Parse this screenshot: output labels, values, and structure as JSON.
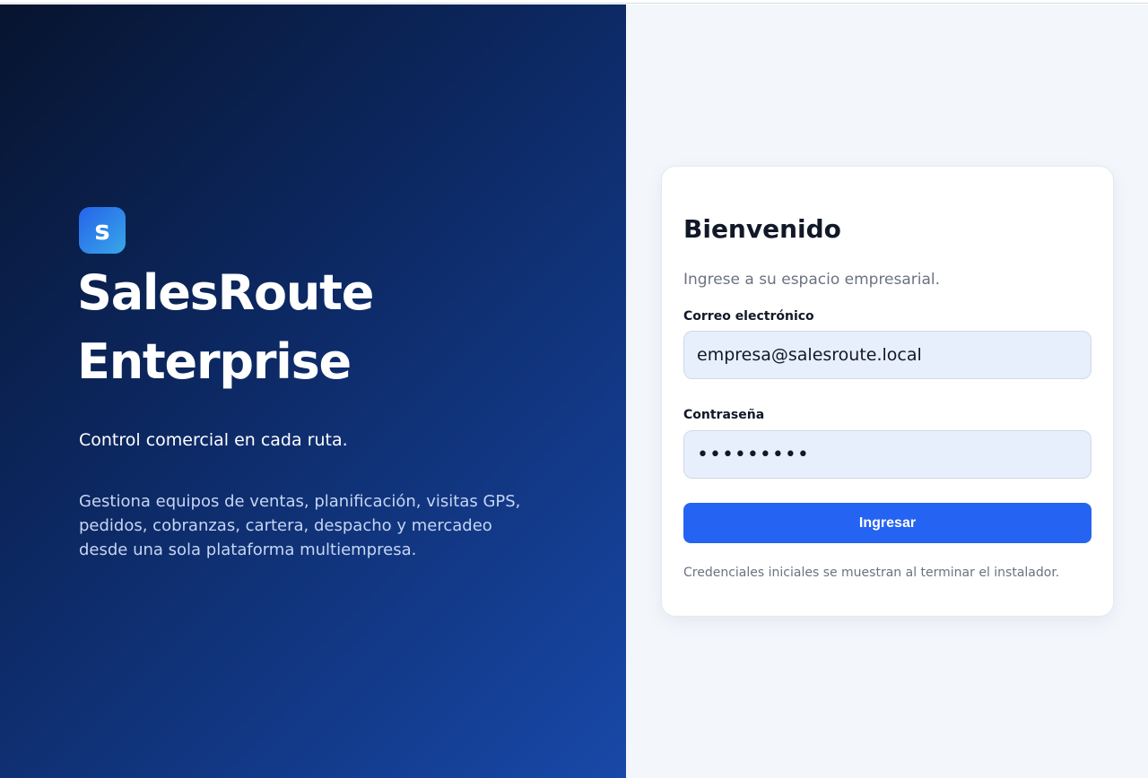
{
  "brand": {
    "logo_letter": "s",
    "name": "SalesRoute Enterprise",
    "tagline": "Control comercial en cada ruta.",
    "description": "Gestiona equipos de ventas, planificación, visitas GPS, pedidos, cobranzas, cartera, despacho y mercadeo desde una sola plataforma multiempresa."
  },
  "login": {
    "title": "Bienvenido",
    "subtitle": "Ingrese a su espacio empresarial.",
    "email_label": "Correo electrónico",
    "email_value": "empresa@salesroute.local",
    "password_label": "Contraseña",
    "password_value": "123456789",
    "submit_label": "Ingresar",
    "note": "Credenciales iniciales se muestran al terminar el instalador."
  },
  "colors": {
    "hero_gradient_start": "#07142f",
    "hero_gradient_end": "#1848a8",
    "primary_button": "#2563f2",
    "input_background": "#e8effc",
    "page_background": "#f3f6fb"
  }
}
